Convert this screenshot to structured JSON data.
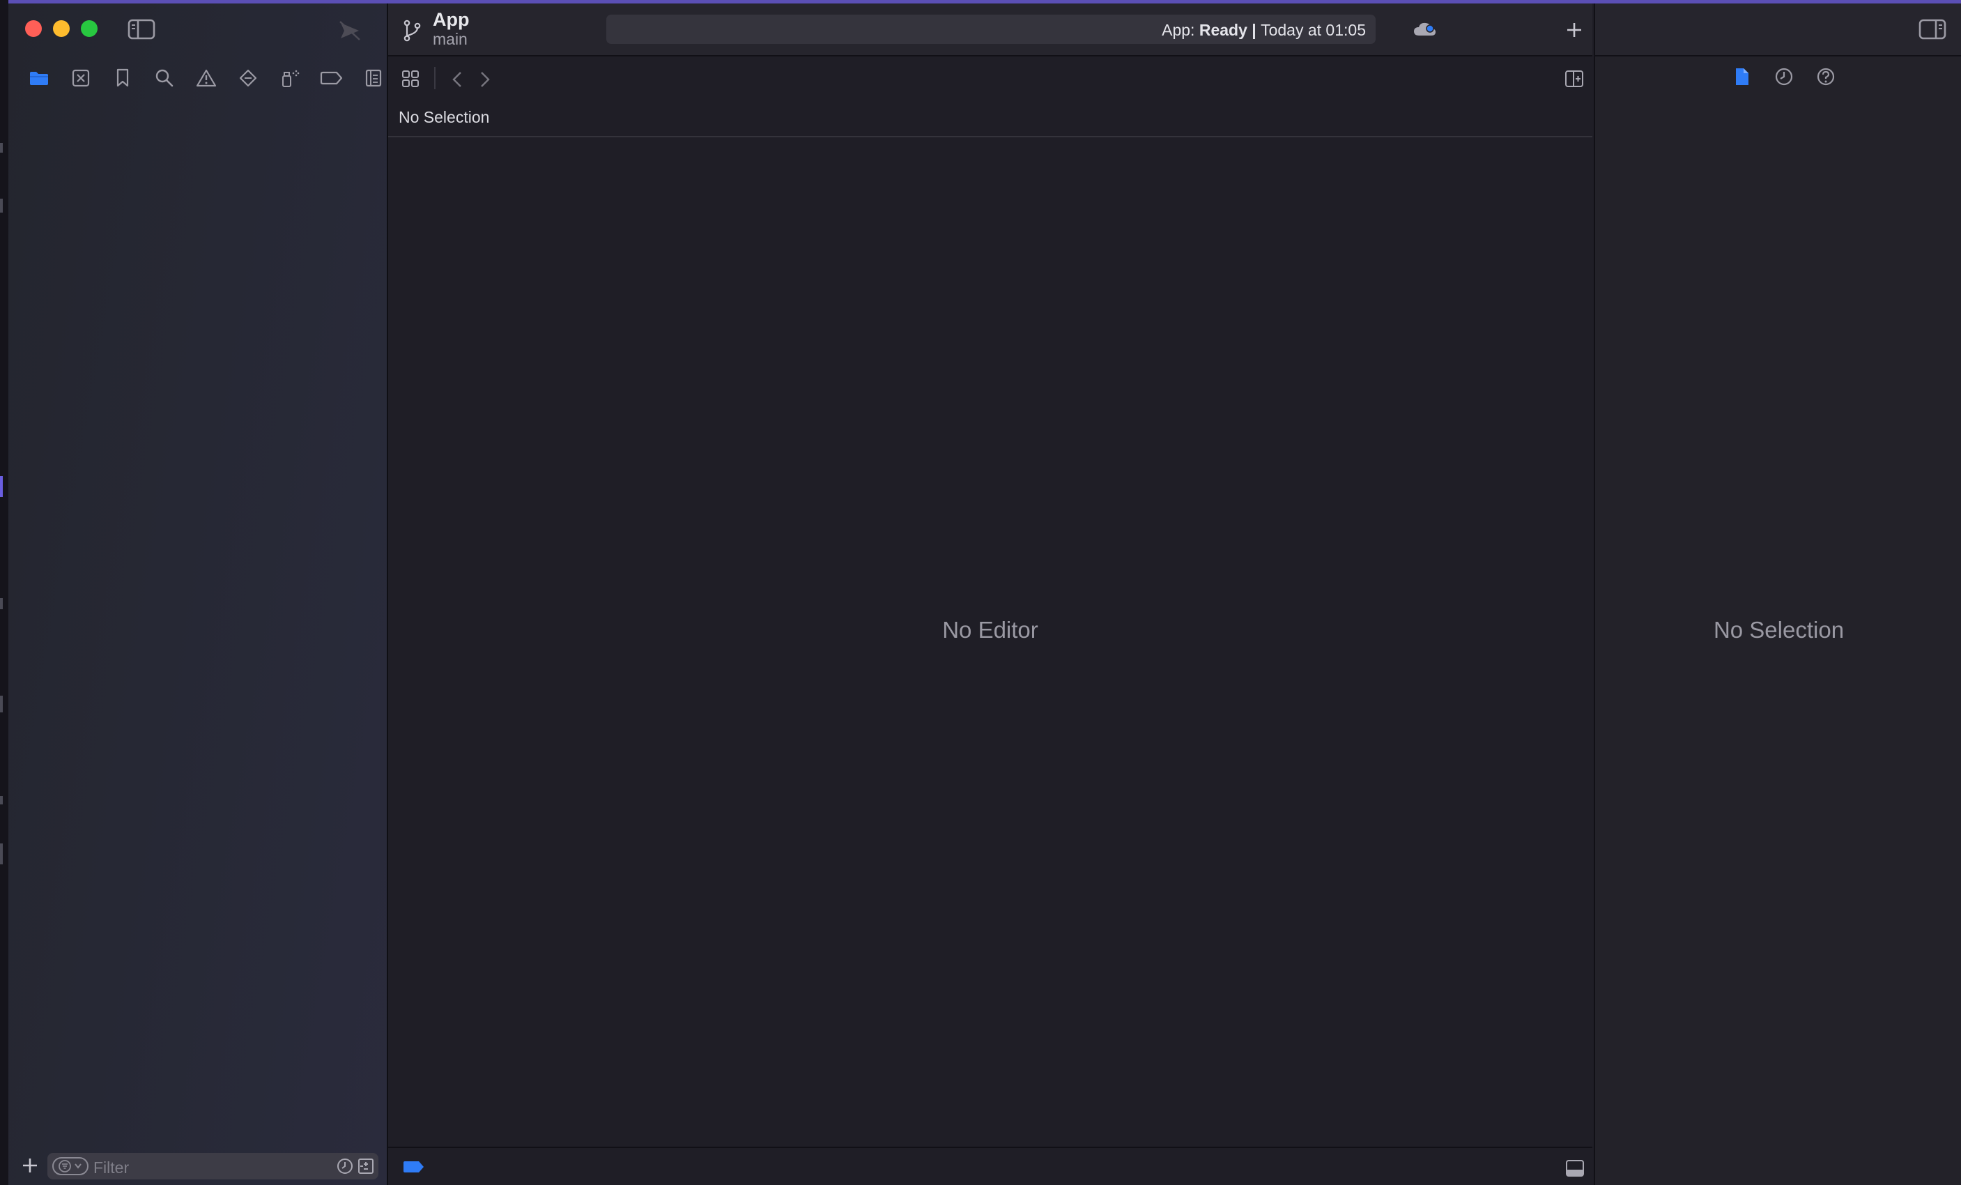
{
  "window": {
    "scheme": {
      "title": "App",
      "branch": "main"
    },
    "activity": {
      "prefix": "App: ",
      "status": "Ready",
      "separator": " | ",
      "time": "Today at 01:05"
    }
  },
  "navigator": {
    "tabs": [
      {
        "name": "project-navigator-tab",
        "icon": "folder-icon",
        "selected": true
      },
      {
        "name": "source-control-navigator-tab",
        "icon": "source-control-icon"
      },
      {
        "name": "bookmark-navigator-tab",
        "icon": "bookmark-icon"
      },
      {
        "name": "find-navigator-tab",
        "icon": "search-icon"
      },
      {
        "name": "issue-navigator-tab",
        "icon": "warning-icon"
      },
      {
        "name": "test-navigator-tab",
        "icon": "diamond-icon"
      },
      {
        "name": "debug-navigator-tab",
        "icon": "spray-icon"
      },
      {
        "name": "breakpoint-navigator-tab",
        "icon": "breakpoint-icon"
      },
      {
        "name": "report-navigator-tab",
        "icon": "report-icon"
      }
    ],
    "filter_placeholder": "Filter"
  },
  "editor": {
    "path_bar": "No Selection",
    "empty_label": "No Editor"
  },
  "inspector": {
    "tabs": [
      "file-inspector-icon",
      "history-inspector-icon",
      "help-inspector-icon"
    ],
    "empty_label": "No Selection"
  },
  "colors": {
    "accent": "#2f7cf6",
    "close": "#ff5f57",
    "minimize": "#febc2e",
    "zoom": "#28c840"
  }
}
